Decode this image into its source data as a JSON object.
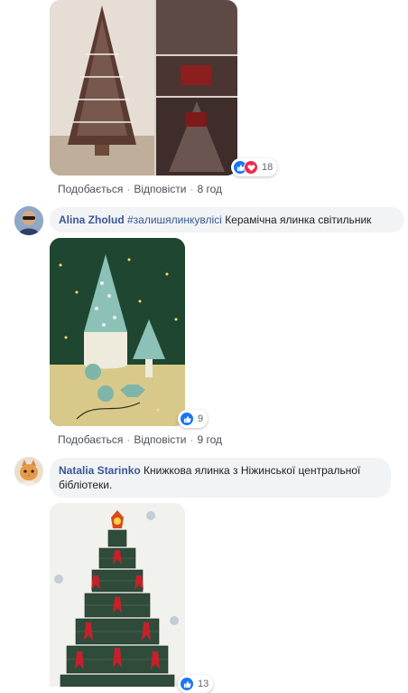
{
  "colors": {
    "link": "#385898",
    "like": "#1877f2",
    "love": "#f0284a",
    "bubble": "#f2f3f5"
  },
  "comments": [
    {
      "photo_icon": "christmas-tree-collage-photo",
      "reactions_count": "18",
      "reaction_icons": [
        "like-icon",
        "love-icon"
      ],
      "actions": {
        "like": "Подобається",
        "reply": "Відповісти",
        "time": "8 год"
      }
    },
    {
      "author": "Alina Zholud",
      "hashtag": "#залишялинкувлісі",
      "text": "Керамічна ялинка світильник",
      "avatar_icon": "man-with-sunglasses-avatar",
      "photo_icon": "ceramic-tree-lamp-photo",
      "reactions_count": "9",
      "reaction_icons": [
        "like-icon"
      ],
      "actions": {
        "like": "Подобається",
        "reply": "Відповісти",
        "time": "9 год"
      }
    },
    {
      "author": "Natalia Starinko",
      "text": "Книжкова ялинка з Ніжинської центральної бібліотеки.",
      "avatar_icon": "cat-avatar",
      "photo_icon": "book-christmas-tree-photo",
      "reactions_count": "13",
      "reaction_icons": [
        "like-icon"
      ]
    }
  ]
}
